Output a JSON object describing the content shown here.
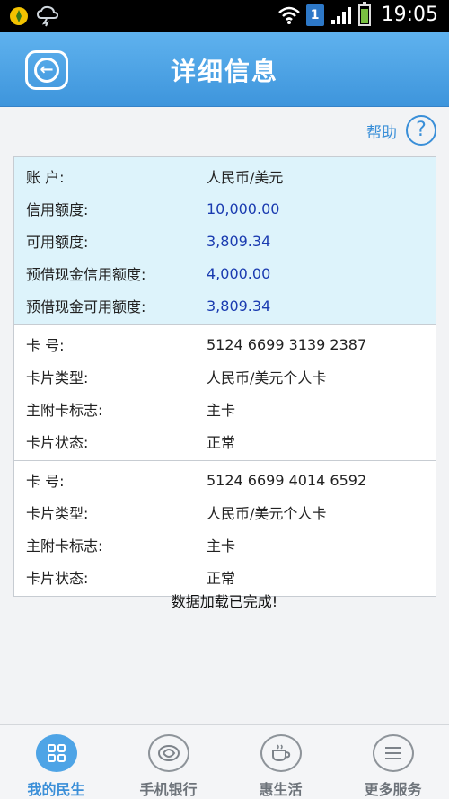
{
  "status_bar": {
    "time": "19:05",
    "notification_badge": "1"
  },
  "header": {
    "title": "详细信息"
  },
  "help": {
    "label": "帮助"
  },
  "account": {
    "rows": [
      {
        "label": "账 户:",
        "value": "人民币/美元"
      },
      {
        "label": "信用额度:",
        "value": "10,000.00"
      },
      {
        "label": "可用额度:",
        "value": "3,809.34"
      },
      {
        "label": "预借现金信用额度:",
        "value": "4,000.00"
      },
      {
        "label": "预借现金可用额度:",
        "value": "3,809.34"
      }
    ]
  },
  "cards": [
    {
      "rows": [
        {
          "label": "卡 号:",
          "value": "5124 6699 3139 2387"
        },
        {
          "label": "卡片类型:",
          "value": "人民币/美元个人卡"
        },
        {
          "label": "主附卡标志:",
          "value": "主卡"
        },
        {
          "label": "卡片状态:",
          "value": "正常"
        }
      ]
    },
    {
      "rows": [
        {
          "label": "卡 号:",
          "value": "5124 6699 4014 6592"
        },
        {
          "label": "卡片类型:",
          "value": "人民币/美元个人卡"
        },
        {
          "label": "主附卡标志:",
          "value": "主卡"
        },
        {
          "label": "卡片状态:",
          "value": "正常"
        }
      ]
    }
  ],
  "status_message": "数据加载已完成!",
  "bottom_nav": {
    "items": [
      {
        "label": "我的民生",
        "icon": "grid-icon",
        "active": true
      },
      {
        "label": "手机银行",
        "icon": "bank-logo-icon",
        "active": false
      },
      {
        "label": "惠生活",
        "icon": "coffee-cup-icon",
        "active": false
      },
      {
        "label": "更多服务",
        "icon": "menu-icon",
        "active": false
      }
    ]
  },
  "colors": {
    "header": "#4aa3e6",
    "account_bg": "#ddf3fb",
    "value_blue": "#1a3bb0",
    "accent": "#3a8fd8"
  }
}
